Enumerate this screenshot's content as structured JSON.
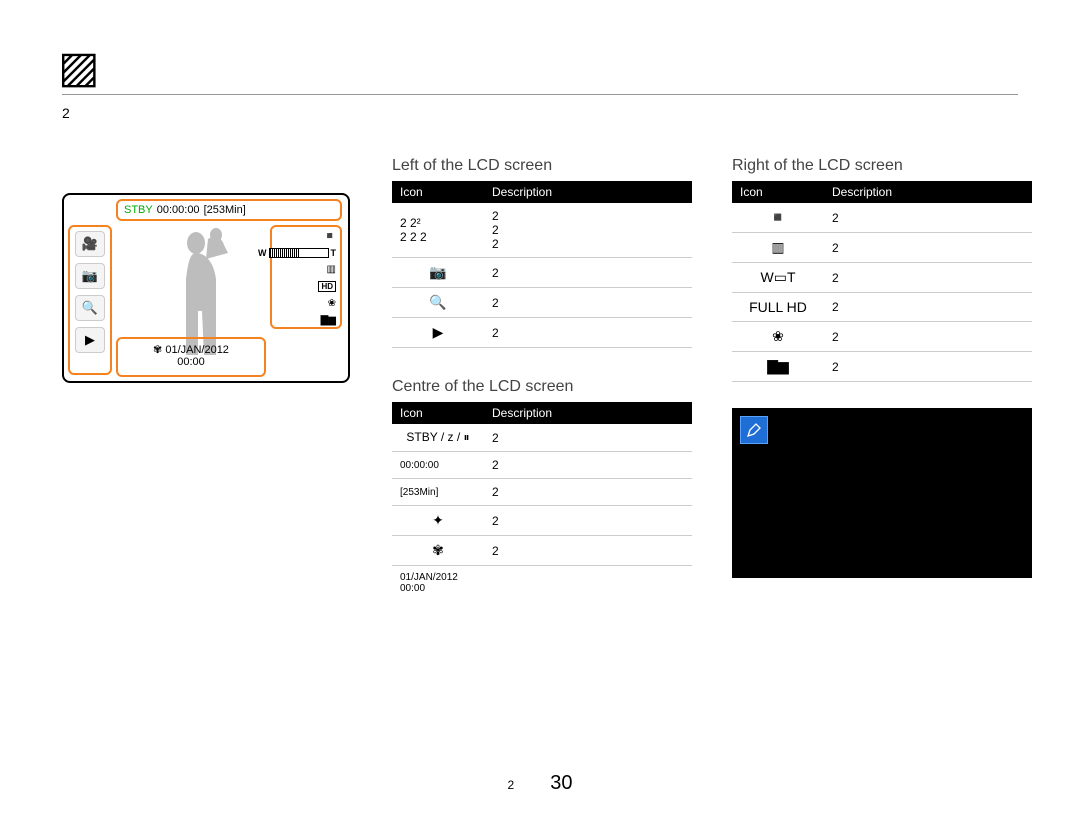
{
  "header": {
    "top_marker": "2"
  },
  "lcd": {
    "stby_label": "STBY",
    "time_code": "00:00:00",
    "remaining": "[253Min]",
    "date": "01/JAN/2012",
    "clock": "00:00"
  },
  "left_table": {
    "title": "Left of the LCD screen",
    "columns": {
      "icon": "Icon",
      "desc": "Description"
    },
    "rows": [
      {
        "icon_text": "2  2²\n2  2  2",
        "desc": "2\n2\n2"
      },
      {
        "icon_name": "camera-icon",
        "icon_glyph": "📷",
        "desc": "2"
      },
      {
        "icon_name": "zoom-icon",
        "icon_glyph": "🔍",
        "desc": "2"
      },
      {
        "icon_name": "play-icon",
        "icon_glyph": "▶",
        "desc": "2"
      }
    ]
  },
  "centre_table": {
    "title": "Centre of the LCD screen",
    "columns": {
      "icon": "Icon",
      "desc": "Description"
    },
    "rows": [
      {
        "icon_html": "STBY / z / ⏸",
        "klass": "red",
        "desc": "2"
      },
      {
        "icon_text": "00:00:00",
        "klass": "tiny",
        "desc": "2"
      },
      {
        "icon_text": "[253Min]",
        "klass": "tiny",
        "desc": "2"
      },
      {
        "icon_name": "sparkle-icon",
        "icon_glyph": "✦",
        "desc": "2"
      },
      {
        "icon_name": "propeller-clock-icon",
        "icon_glyph": "✾",
        "desc": "2"
      },
      {
        "icon_text": "01/JAN/2012\n00:00",
        "klass": "tiny",
        "desc": "",
        "no_border": true
      }
    ]
  },
  "right_table": {
    "title": "Right of the LCD screen",
    "columns": {
      "icon": "Icon",
      "desc": "Description"
    },
    "rows": [
      {
        "icon_name": "sd-card-icon",
        "icon_glyph": "◾",
        "desc": "2"
      },
      {
        "icon_name": "battery-icon",
        "icon_glyph": "▥",
        "desc": "2"
      },
      {
        "icon_name": "zoom-wt-icon",
        "icon_glyph": "W▭T",
        "desc": "2"
      },
      {
        "icon_name": "full-hd-icon",
        "icon_glyph": "FULL HD",
        "desc": "2"
      },
      {
        "icon_name": "flower-macro-icon",
        "icon_glyph": "❀",
        "desc": "2"
      },
      {
        "icon_name": "bars-icon",
        "icon_glyph": "▇▆",
        "desc": "2"
      }
    ]
  },
  "footer": {
    "chapter_marker": "2",
    "page_number": "30"
  }
}
